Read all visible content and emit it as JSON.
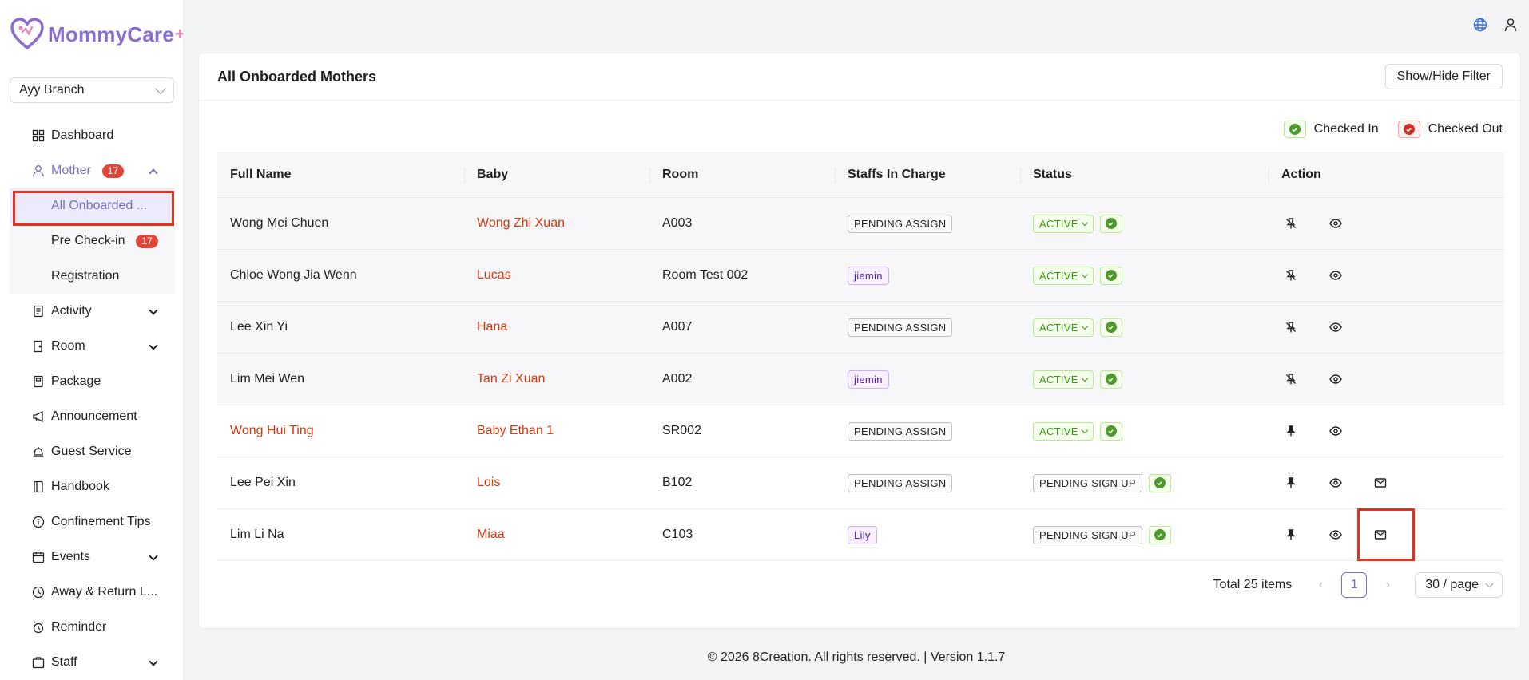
{
  "app": {
    "logo_text": "MommyCare",
    "logo_plus": "+"
  },
  "branch_select": {
    "value": "Ayy Branch"
  },
  "sidebar": {
    "dashboard": "Dashboard",
    "mother": {
      "label": "Mother",
      "badge": "17"
    },
    "mother_sub": {
      "all_onboarded": "All Onboarded ...",
      "pre_checkin": "Pre Check-in",
      "pre_checkin_badge": "17",
      "registration": "Registration"
    },
    "activity": "Activity",
    "room": "Room",
    "package": "Package",
    "announcement": "Announcement",
    "guest_service": "Guest Service",
    "handbook": "Handbook",
    "confinement_tips": "Confinement Tips",
    "events": "Events",
    "away_return": "Away & Return L...",
    "reminder": "Reminder",
    "staff": "Staff"
  },
  "card": {
    "title": "All Onboarded Mothers",
    "filter_button": "Show/Hide Filter"
  },
  "legend": {
    "checked_in": "Checked In",
    "checked_out": "Checked Out"
  },
  "table": {
    "headers": [
      "Full Name",
      "Baby",
      "Room",
      "Staffs In Charge",
      "Status",
      "Action"
    ],
    "rows": [
      {
        "name": "Wong Mei Chuen",
        "baby": "Wong Zhi Xuan",
        "room": "A003",
        "staff": "PENDING ASSIGN",
        "status": "ACTIVE"
      },
      {
        "name": "Chloe Wong Jia Wenn",
        "baby": "Lucas",
        "room": "Room Test 002",
        "staff": "jiemin",
        "status": "ACTIVE"
      },
      {
        "name": "Lee Xin Yi",
        "baby": "Hana",
        "room": "A007",
        "staff": "PENDING ASSIGN",
        "status": "ACTIVE"
      },
      {
        "name": "Lim Mei Wen",
        "baby": "Tan Zi Xuan",
        "room": "A002",
        "staff": "jiemin",
        "status": "ACTIVE"
      },
      {
        "name": "Wong Hui Ting",
        "baby": "Baby Ethan 1",
        "room": "SR002",
        "staff": "PENDING ASSIGN",
        "status": "ACTIVE"
      },
      {
        "name": "Lee Pei Xin",
        "baby": "Lois",
        "room": "B102",
        "staff": "PENDING ASSIGN",
        "status": "PENDING SIGN UP"
      },
      {
        "name": "Lim Li Na",
        "baby": "Miaa",
        "room": "C103",
        "staff": "Lily",
        "status": "PENDING SIGN UP"
      }
    ]
  },
  "pagination": {
    "total": "Total 25 items",
    "current_page": "1",
    "page_size": "30 / page"
  },
  "footer": "© 2026 8Creation. All rights reserved. | Version 1.1.7",
  "colors": {
    "accent": "#7a6cc7",
    "highlight": "#e0341e",
    "red_text": "#d4380d"
  }
}
